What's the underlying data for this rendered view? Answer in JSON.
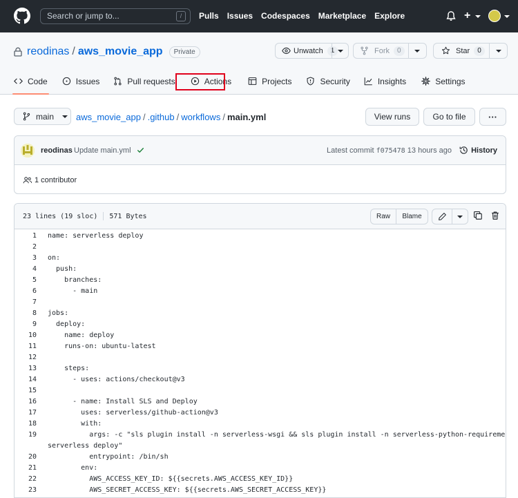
{
  "header": {
    "search_placeholder": "Search or jump to...",
    "search_key": "/",
    "nav": [
      "Pulls",
      "Issues",
      "Codespaces",
      "Marketplace",
      "Explore"
    ],
    "plus": "+"
  },
  "repo": {
    "owner": "reodinas",
    "separator": "/",
    "name": "aws_movie_app",
    "visibility": "Private",
    "watch_label": "Unwatch",
    "watch_count": "1",
    "fork_label": "Fork",
    "fork_count": "0",
    "star_label": "Star",
    "star_count": "0"
  },
  "tabs": [
    {
      "label": "Code",
      "icon": "code-icon",
      "active": true
    },
    {
      "label": "Issues",
      "icon": "issue-opened-icon"
    },
    {
      "label": "Pull requests",
      "icon": "git-pull-request-icon"
    },
    {
      "label": "Actions",
      "icon": "play-icon",
      "highlighted": true
    },
    {
      "label": "Projects",
      "icon": "table-icon"
    },
    {
      "label": "Security",
      "icon": "shield-icon"
    },
    {
      "label": "Insights",
      "icon": "graph-icon"
    },
    {
      "label": "Settings",
      "icon": "gear-icon"
    }
  ],
  "highlight_color": "#e0001b",
  "breadcrumb": {
    "branch": "main",
    "parts": [
      "aws_movie_app",
      ".github",
      "workflows"
    ],
    "separator": "/",
    "file": "main.yml",
    "view_runs": "View runs",
    "go_to_file": "Go to file",
    "more": "···"
  },
  "commit": {
    "author": "reodinas",
    "message": "Update main.yml",
    "latest_label": "Latest commit",
    "sha": "f075478",
    "time": "13 hours ago",
    "history_label": "History",
    "contributors": "1 contributor"
  },
  "file": {
    "lines_info": "23 lines (19 sloc)",
    "size": "571 Bytes",
    "raw": "Raw",
    "blame": "Blame"
  },
  "code_lines": [
    {
      "n": "1",
      "text": "name: serverless deploy"
    },
    {
      "n": "2",
      "text": ""
    },
    {
      "n": "3",
      "text": "on:"
    },
    {
      "n": "4",
      "text": "  push:"
    },
    {
      "n": "5",
      "text": "    branches:"
    },
    {
      "n": "6",
      "text": "      - main"
    },
    {
      "n": "7",
      "text": ""
    },
    {
      "n": "8",
      "text": "jobs:"
    },
    {
      "n": "9",
      "text": "  deploy:"
    },
    {
      "n": "10",
      "text": "    name: deploy"
    },
    {
      "n": "11",
      "text": "    runs-on: ubuntu-latest"
    },
    {
      "n": "12",
      "text": ""
    },
    {
      "n": "13",
      "text": "    steps:"
    },
    {
      "n": "14",
      "text": "      - uses: actions/checkout@v3"
    },
    {
      "n": "15",
      "text": ""
    },
    {
      "n": "16",
      "text": "      - name: Install SLS and Deploy"
    },
    {
      "n": "17",
      "text": "        uses: serverless/github-action@v3"
    },
    {
      "n": "18",
      "text": "        with:"
    },
    {
      "n": "19",
      "text": "          args: -c \"sls plugin install -n serverless-wsgi && sls plugin install -n serverless-python-requirements &&"
    },
    {
      "n": "",
      "text": "serverless deploy\""
    },
    {
      "n": "20",
      "text": "          entrypoint: /bin/sh"
    },
    {
      "n": "21",
      "text": "        env:"
    },
    {
      "n": "22",
      "text": "          AWS_ACCESS_KEY_ID: ${{secrets.AWS_ACCESS_KEY_ID}}"
    },
    {
      "n": "23",
      "text": "          AWS_SECRET_ACCESS_KEY: ${{secrets.AWS_SECRET_ACCESS_KEY}}"
    }
  ]
}
